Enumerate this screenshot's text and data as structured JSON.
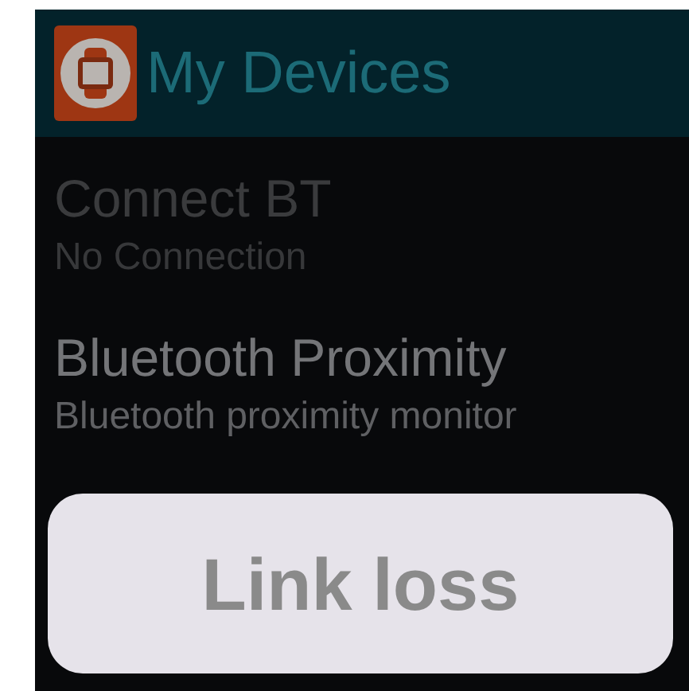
{
  "action_bar": {
    "title": "My Devices"
  },
  "items": [
    {
      "title": "Connect BT",
      "subtitle": "No Connection",
      "disabled": true
    },
    {
      "title": "Bluetooth Proximity",
      "subtitle": "Bluetooth proximity monitor",
      "disabled": false
    }
  ],
  "toast": {
    "message": "Link loss"
  }
}
